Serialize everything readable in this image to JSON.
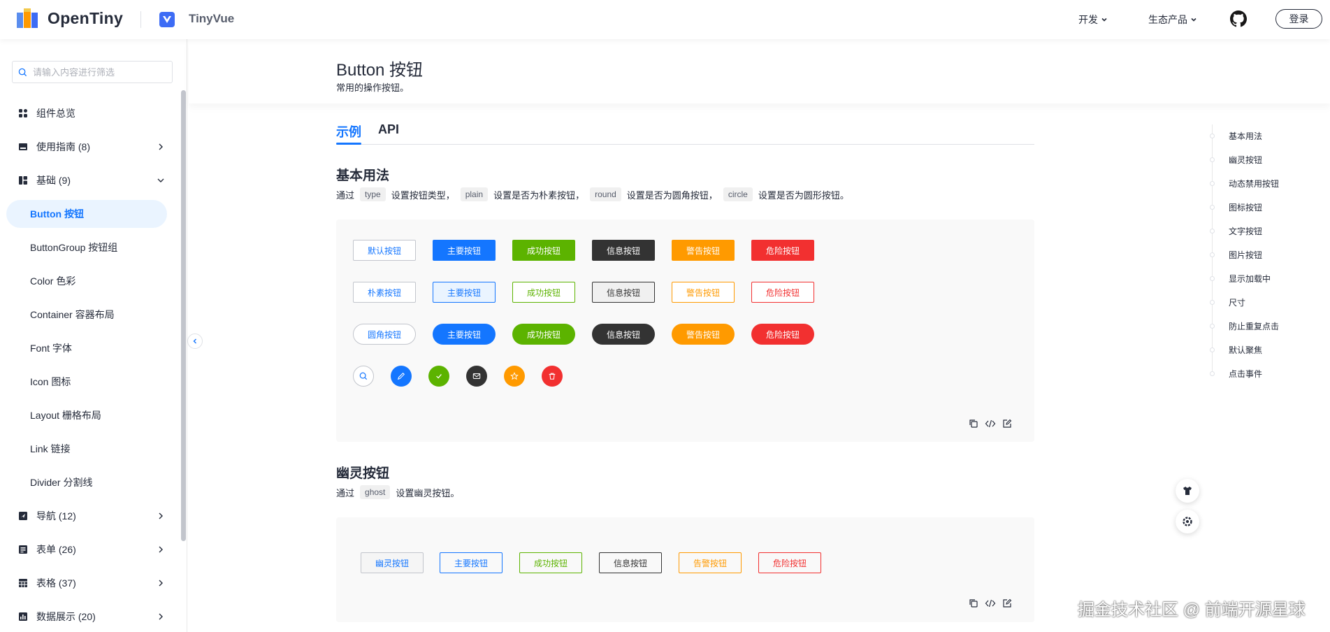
{
  "header": {
    "brand": "OpenTiny",
    "product": "TinyVue",
    "nav_dev": "开发",
    "nav_eco": "生态产品",
    "login": "登录"
  },
  "sidebar": {
    "search_placeholder": "请输入内容进行筛选",
    "groups": [
      {
        "label": "组件总览",
        "icon": "grid-icon"
      },
      {
        "label": "使用指南 (8)",
        "icon": "book-icon"
      },
      {
        "label": "基础 (9)",
        "icon": "layout-icon"
      }
    ],
    "basic_items": [
      "Button 按钮",
      "ButtonGroup 按钮组",
      "Color 色彩",
      "Container 容器布局",
      "Font 字体",
      "Icon 图标",
      "Layout 栅格布局",
      "Link 链接",
      "Divider 分割线"
    ],
    "more_groups": [
      {
        "label": "导航 (12)",
        "icon": "navigation-icon"
      },
      {
        "label": "表单 (26)",
        "icon": "form-icon"
      },
      {
        "label": "表格 (37)",
        "icon": "table-icon"
      },
      {
        "label": "数据展示 (20)",
        "icon": "data-icon"
      }
    ]
  },
  "page": {
    "title": "Button 按钮",
    "desc": "常用的操作按钮。",
    "tabs": [
      "示例",
      "API"
    ]
  },
  "sections": {
    "basic": {
      "title": "基本用法",
      "desc_parts": [
        "通过",
        "type",
        "设置按钮类型，",
        "plain",
        "设置是否为朴素按钮，",
        "round",
        "设置是否为圆角按钮，",
        "circle",
        "设置是否为圆形按钮。"
      ],
      "row1": [
        "默认按钮",
        "主要按钮",
        "成功按钮",
        "信息按钮",
        "警告按钮",
        "危险按钮"
      ],
      "row2": [
        "朴素按钮",
        "主要按钮",
        "成功按钮",
        "信息按钮",
        "警告按钮",
        "危险按钮"
      ],
      "row3": [
        "圆角按钮",
        "主要按钮",
        "成功按钮",
        "信息按钮",
        "警告按钮",
        "危险按钮"
      ],
      "row4_icons": [
        "search-icon",
        "edit-icon",
        "check-icon",
        "mail-icon",
        "star-icon",
        "delete-icon"
      ]
    },
    "ghost": {
      "title": "幽灵按钮",
      "desc_parts": [
        "通过",
        "ghost",
        "设置幽灵按钮。"
      ],
      "buttons": [
        "幽灵按钮",
        "主要按钮",
        "成功按钮",
        "信息按钮",
        "告警按钮",
        "危险按钮"
      ]
    }
  },
  "anchors": [
    "基本用法",
    "幽灵按钮",
    "动态禁用按钮",
    "图标按钮",
    "文字按钮",
    "图片按钮",
    "显示加载中",
    "尺寸",
    "防止重复点击",
    "默认聚焦",
    "点击事件"
  ],
  "colors": {
    "primary": "#1476ff",
    "success": "#5cb300",
    "info": "#333333",
    "warning": "#ff9a00",
    "danger": "#f23030"
  },
  "watermark": "掘金技术社区 @ 前端开源星球"
}
